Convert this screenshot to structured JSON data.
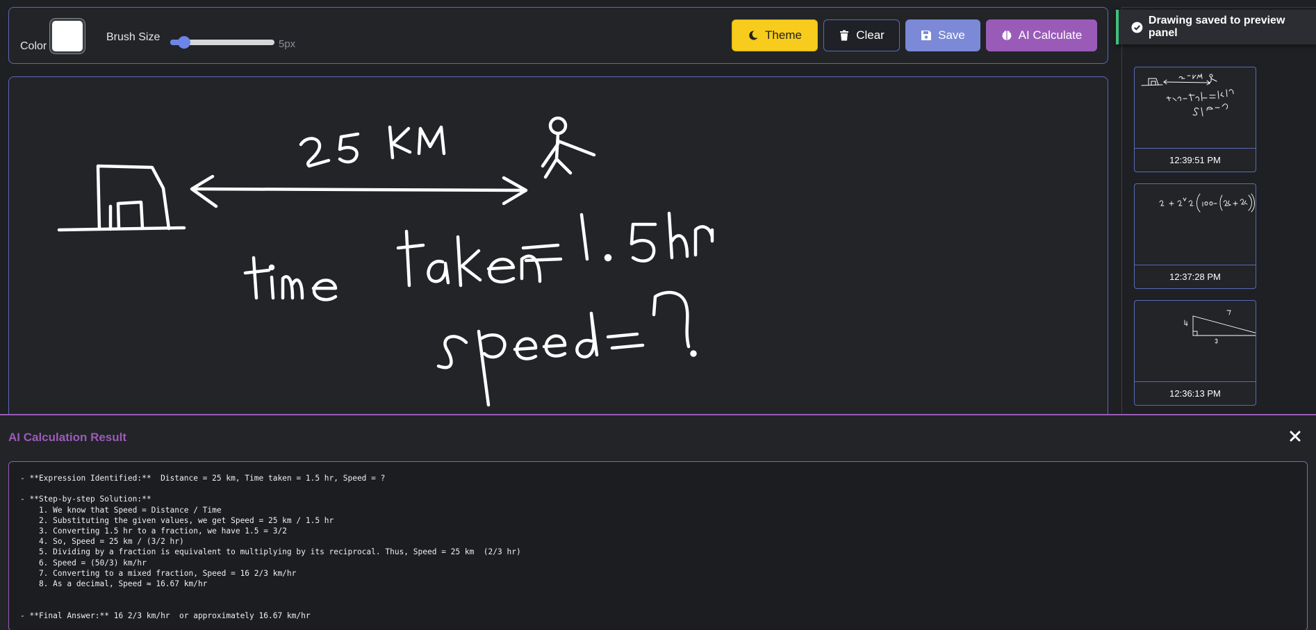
{
  "toolbar": {
    "color_label": "Color",
    "color_value": "#ffffff",
    "brush_label": "Brush Size",
    "brush_value_text": "5px",
    "brush_fraction": 0.08,
    "buttons": {
      "theme": "Theme",
      "clear": "Clear",
      "save": "Save",
      "ai": "AI Calculate"
    }
  },
  "toast": {
    "message": "Drawing saved to preview panel",
    "accent": "#3fbf7f"
  },
  "previews": [
    {
      "time": "12:39:51 PM"
    },
    {
      "time": "12:37:28 PM"
    },
    {
      "time": "12:36:13 PM"
    }
  ],
  "result": {
    "title": "AI Calculation Result",
    "text": "- **Expression Identified:**  Distance = 25 km, Time taken = 1.5 hr, Speed = ?\n\n- **Step-by-step Solution:**\n    1. We know that Speed = Distance / Time\n    2. Substituting the given values, we get Speed = 25 km / 1.5 hr\n    3. Converting 1.5 hr to a fraction, we have 1.5 = 3/2\n    4. So, Speed = 25 km / (3/2 hr)\n    5. Dividing by a fraction is equivalent to multiplying by its reciprocal. Thus, Speed = 25 km  (2/3 hr)\n    6. Speed = (50/3) km/hr\n    7. Converting to a mixed fraction, Speed = 16 2/3 km/hr\n    8. As a decimal, Speed ≈ 16.67 km/hr\n\n\n- **Final Answer:** 16 2/3 km/hr  or approximately 16.67 km/hr"
  },
  "colors": {
    "accent_blue": "#5a6bb5",
    "theme_yellow": "#f7cc1c",
    "save_blue": "#7b89d6",
    "ai_purple": "#9a5bb8",
    "background": "#1f2023"
  },
  "icons": {
    "theme": "moon-icon",
    "clear": "trash-icon",
    "save": "floppy-disk-icon",
    "ai": "brain-icon",
    "toast": "check-circle-icon",
    "close": "close-icon"
  }
}
